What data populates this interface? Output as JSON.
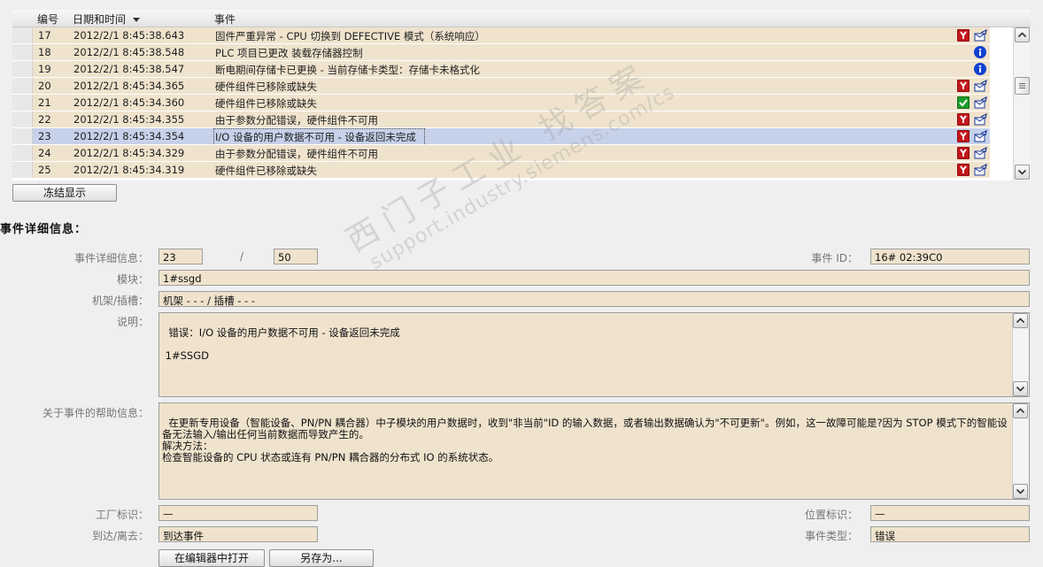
{
  "table": {
    "columns": {
      "number": "编号",
      "datetime": "日期和时间",
      "event": "事件"
    },
    "rows": [
      {
        "no": "17",
        "datetime": "2012/2/1 8:45:38.643",
        "event": "固件严重异常 - CPU 切换到 DEFECTIVE 模式（系统响应）",
        "icon1": "error-repair-icon",
        "icon2": "acknowledge-icon"
      },
      {
        "no": "18",
        "datetime": "2012/2/1 8:45:38.548",
        "event": "PLC 项目已更改 装载存储器控制",
        "icon1": "",
        "icon2": "info-icon"
      },
      {
        "no": "19",
        "datetime": "2012/2/1 8:45:38.547",
        "event": "断电期间存储卡已更换 - 当前存储卡类型：存储卡未格式化",
        "icon1": "",
        "icon2": "info-icon"
      },
      {
        "no": "20",
        "datetime": "2012/2/1 8:45:34.365",
        "event": "硬件组件已移除或缺失",
        "icon1": "error-repair-icon",
        "icon2": "acknowledge-icon"
      },
      {
        "no": "21",
        "datetime": "2012/2/1 8:45:34.360",
        "event": "硬件组件已移除或缺失",
        "icon1": "ok-check-icon",
        "icon2": "acknowledge-icon"
      },
      {
        "no": "22",
        "datetime": "2012/2/1 8:45:34.355",
        "event": "由于参数分配错误，硬件组件不可用",
        "icon1": "error-repair-icon",
        "icon2": "acknowledge-icon"
      },
      {
        "no": "23",
        "datetime": "2012/2/1 8:45:34.354",
        "event": "I/O 设备的用户数据不可用 - 设备返回未完成",
        "icon1": "error-repair-icon",
        "icon2": "acknowledge-icon",
        "selected": true
      },
      {
        "no": "24",
        "datetime": "2012/2/1 8:45:34.329",
        "event": "由于参数分配错误，硬件组件不可用",
        "icon1": "error-repair-icon",
        "icon2": "acknowledge-icon"
      },
      {
        "no": "25",
        "datetime": "2012/2/1 8:45:34.319",
        "event": "硬件组件已移除或缺失",
        "icon1": "error-repair-icon",
        "icon2": "acknowledge-icon"
      }
    ]
  },
  "freeze_button": "冻结显示",
  "details": {
    "section_title": "事件详细信息：",
    "event_details_label": "事件详细信息：",
    "current_index": "23",
    "separator": "/",
    "total": "50",
    "event_id_label": "事件 ID：",
    "event_id": "16# 02:39C0",
    "module_label": "模块：",
    "module": "1#ssgd",
    "rack_slot_label": "机架/插槽：",
    "rack_slot": "机架 - - - / 插槽 - - -",
    "description_label": "说明：",
    "description": "错误：I/O 设备的用户数据不可用 - 设备返回未完成\n\n 1#SSGD",
    "help_label": "关于事件的帮助信息：",
    "help": "在更新专用设备（智能设备、PN/PN 耦合器）中子模块的用户数据时，收到\"非当前\"ID 的输入数据，或者输出数据确认为\"不可更新\"。例如，这一故障可能是?因为 STOP 模式下的智能设备无法输入/输出任何当前数据而导致产生的。\n解决方法：\n检查智能设备的 CPU 状态或连有 PN/PN 耦合器的分布式 IO 的系统状态。",
    "plant_id_label": "工厂标识：",
    "plant_id": "—",
    "location_id_label": "位置标识：",
    "location_id": "—",
    "arrive_leave_label": "到达/离去：",
    "arrive_leave": "到达事件",
    "event_type_label": "事件类型：",
    "event_type": "错误"
  },
  "bottom_buttons": {
    "open_editor": "在编辑器中打开",
    "save_as": "另存为..."
  },
  "watermark": {
    "line1": "西门子工业  找答案",
    "line2": "support.industry.siemens.com/cs"
  },
  "colors": {
    "row_bg": "#f0e3cd",
    "selected_row_bg": "#c6d1ea",
    "error_red": "#c3161c",
    "ok_green": "#1e9c2b",
    "info_blue": "#1040d0"
  }
}
